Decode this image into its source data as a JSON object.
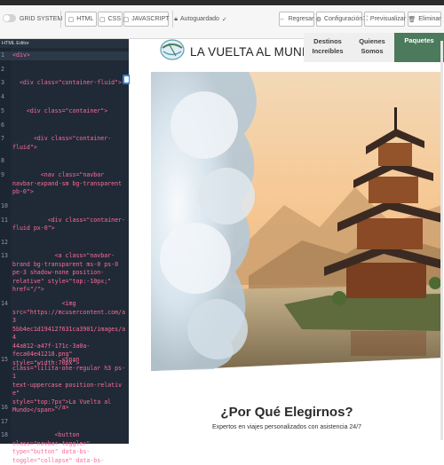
{
  "toolbar": {
    "grid_system": "GRID SYSTEM",
    "tabs": [
      {
        "label": "HTML"
      },
      {
        "label": "CSS"
      },
      {
        "label": "JAVASCRIPT"
      }
    ],
    "autosave": "Autoguardado",
    "back": "Regresar",
    "settings": "Configuración",
    "preview": "Previsualizar",
    "delete": "Eliminar"
  },
  "editor": {
    "title": "HTML Editor",
    "lines": [
      {
        "n": "1",
        "text": "<div>"
      },
      {
        "n": "2",
        "text": ""
      },
      {
        "n": "3",
        "text": "  <div class=\"container-fluid\">"
      },
      {
        "n": "4",
        "text": ""
      },
      {
        "n": "5",
        "text": "    <div class=\"container\">"
      },
      {
        "n": "6",
        "text": ""
      },
      {
        "n": "7",
        "text": "      <div class=\"container-\nfluid\">"
      },
      {
        "n": "8",
        "text": ""
      },
      {
        "n": "9",
        "text": "        <nav class=\"navbar\nnavbar-expand-sm bg-transparent\npb-0\">"
      },
      {
        "n": "10",
        "text": ""
      },
      {
        "n": "11",
        "text": "          <div class=\"container-\nfluid px-0\">"
      },
      {
        "n": "12",
        "text": ""
      },
      {
        "n": "13",
        "text": "            <a class=\"navbar-\nbrand bg-transparent ms-0 ps-0\npe-3 shadow-none position-\nrelative\" style=\"top:-10px;\"\nhref=\"/\">"
      },
      {
        "n": "14",
        "text": "              <img\nsrc=\"https://mcusercontent.com/a3\n5bb4ec1d194127631ca3901/images/a4\n44a812-a47f-171c-3a0a-\nfeca04e41218.png\"\nstyle=\"width:70px\">"
      },
      {
        "n": "15",
        "text": "              <span\nclass=\"lilita-one-regular h3 ps-1\ntext-uppercase position-relative\"\nstyle=\"top:7px\">La Vuelta al\nMundo</span>"
      },
      {
        "n": "16",
        "text": "            </a>"
      },
      {
        "n": "17",
        "text": ""
      },
      {
        "n": "18",
        "text": "            <button\nclass=\"navbar-toggler\"\ntype=\"button\" data-bs-\ntoggle=\"collapse\" data-bs-"
      }
    ]
  },
  "preview": {
    "brand": "LA VUELTA AL MUNDO",
    "nav": {
      "link1": "Destinos\nIncreíbles",
      "link2": "Quienes\nSomos",
      "link3": "Paquetes"
    },
    "heading": "¿Por Qué Elegirnos?",
    "subheading": "Expertos en viajes personalizados con asistencia 24/7"
  },
  "colors": {
    "accent_green": "#4b7b5c",
    "editor_bg": "#1f2a36",
    "tag_pink": "#ff6b9a"
  }
}
